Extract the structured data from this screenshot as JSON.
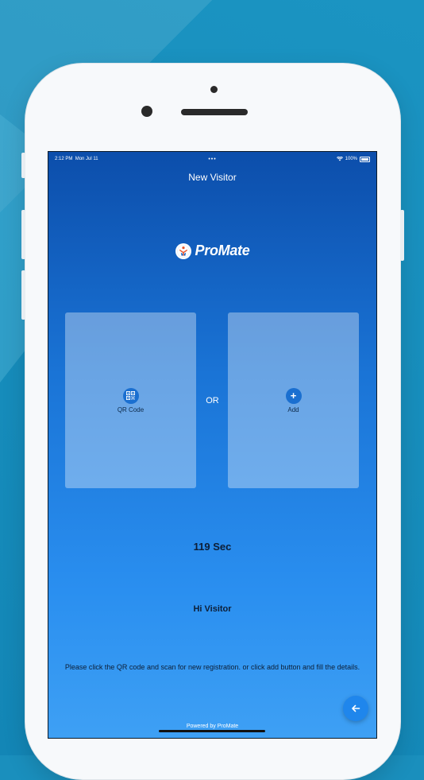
{
  "status_bar": {
    "time": "2:12 PM",
    "date": "Mon Jul 11",
    "dots": "•••",
    "battery_text": "100%"
  },
  "header": {
    "title": "New Visitor"
  },
  "logo": {
    "brand_name": "ProMate"
  },
  "options": {
    "qr": {
      "label": "QR Code",
      "icon": "qr-code-icon"
    },
    "separator": "OR",
    "add": {
      "label": "Add",
      "icon": "plus-icon"
    }
  },
  "timer": {
    "text": "119 Sec"
  },
  "greeting": {
    "text": "Hi Visitor"
  },
  "instructions": {
    "text": "Please click the QR code and scan for new registration. or click add button and fill the details."
  },
  "footer": {
    "powered_by": "Powered by ProMate"
  },
  "fab": {
    "icon": "arrow-left-icon"
  },
  "colors": {
    "accent": "#1f86ec",
    "screen_top": "#0c4eab",
    "screen_bottom": "#3ea0f4",
    "background": "#1a8fbd"
  }
}
